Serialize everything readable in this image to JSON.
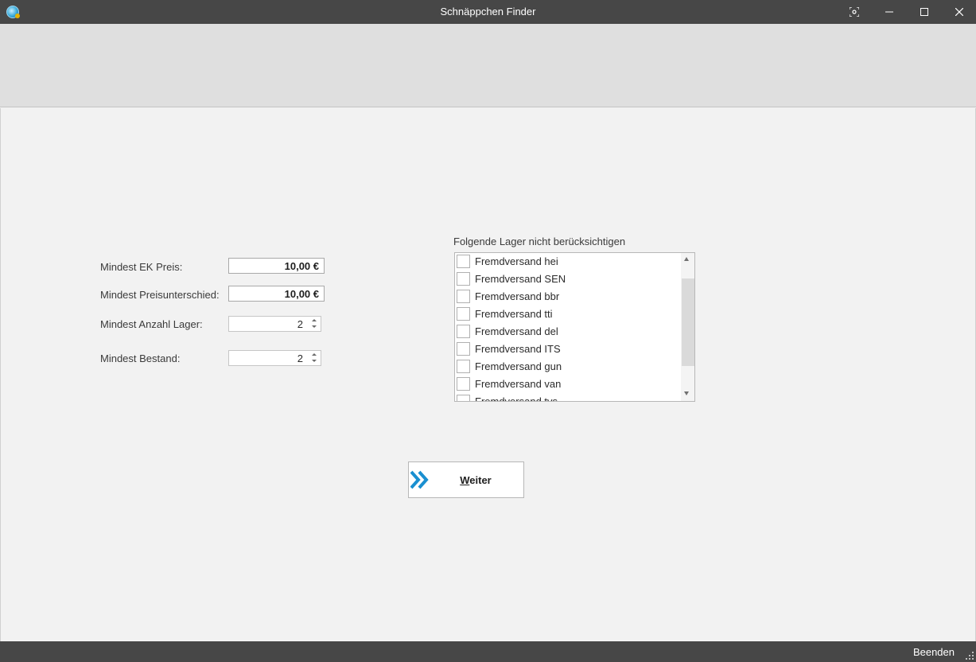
{
  "window": {
    "title": "Schnäppchen Finder"
  },
  "form": {
    "min_ek_label": "Mindest EK Preis:",
    "min_ek_value": "10,00 €",
    "min_diff_label": "Mindest Preisunterschied:",
    "min_diff_value": "10,00 €",
    "min_lager_label": "Mindest Anzahl Lager:",
    "min_lager_value": "2",
    "min_bestand_label": "Mindest Bestand:",
    "min_bestand_value": "2"
  },
  "lager": {
    "caption": "Folgende Lager nicht berücksichtigen",
    "items": [
      {
        "label": "Fremdversand hei",
        "checked": false
      },
      {
        "label": "Fremdversand SEN",
        "checked": false
      },
      {
        "label": "Fremdversand bbr",
        "checked": false
      },
      {
        "label": "Fremdversand tti",
        "checked": false
      },
      {
        "label": "Fremdversand del",
        "checked": false
      },
      {
        "label": "Fremdversand ITS",
        "checked": false
      },
      {
        "label": "Fremdversand gun",
        "checked": false
      },
      {
        "label": "Fremdversand van",
        "checked": false
      },
      {
        "label": "Fremdversand tvs",
        "checked": false
      }
    ]
  },
  "actions": {
    "weiter_label": "Weiter",
    "beenden_label": "Beenden"
  },
  "icons": {
    "app": "app-globe-icon",
    "weiter": "double-chevron-right-icon"
  },
  "colors": {
    "titlebar": "#474747",
    "accent": "#1a8fd0"
  }
}
